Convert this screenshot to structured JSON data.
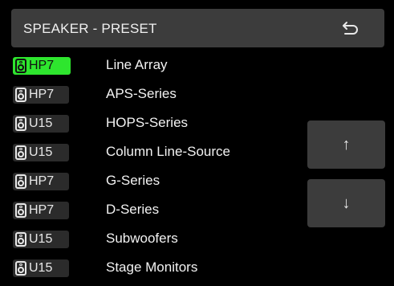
{
  "header": {
    "title": "SPEAKER - PRESET",
    "back_icon": "return-arrow-icon"
  },
  "presets": [
    {
      "model": "HP7",
      "label": "Line Array",
      "selected": true
    },
    {
      "model": "HP7",
      "label": "APS-Series",
      "selected": false
    },
    {
      "model": "U15",
      "label": "HOPS-Series",
      "selected": false
    },
    {
      "model": "U15",
      "label": "Column Line-Source",
      "selected": false
    },
    {
      "model": "HP7",
      "label": "G-Series",
      "selected": false
    },
    {
      "model": "HP7",
      "label": "D-Series",
      "selected": false
    },
    {
      "model": "U15",
      "label": "Subwoofers",
      "selected": false
    },
    {
      "model": "U15",
      "label": "Stage Monitors",
      "selected": false
    }
  ],
  "nav": {
    "up_label": "↑",
    "down_label": "↓"
  },
  "colors": {
    "background": "#000000",
    "panel": "#3c3c3c",
    "badge": "#2b2b2b",
    "selected": "#2ee62e"
  }
}
